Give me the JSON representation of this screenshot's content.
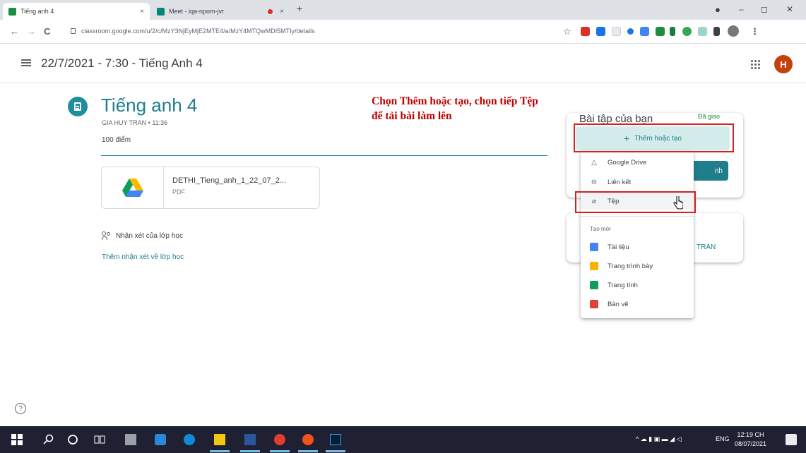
{
  "browser": {
    "tabs": [
      {
        "title": "Tiếng anh 4",
        "close": "×"
      },
      {
        "title": "Meet - iqa-npom-jvr",
        "close": "×"
      }
    ],
    "new_tab": "+",
    "window_controls": {
      "minimize": "–",
      "maximize": "◻",
      "close": "✕"
    },
    "url": "classroom.google.com/u/2/c/MzY3NjEyMjE2MTE4/a/MzY4MTQwMDI5MTIy/details",
    "nav": {
      "back": "←",
      "forward": "→",
      "reload": "C"
    }
  },
  "appbar": {
    "title": "22/7/2021 - 7:30 - Tiếng Anh 4",
    "avatar_letter": "H"
  },
  "assignment": {
    "title": "Tiếng anh 4",
    "meta": "GIA HUY TRAN • 11:36",
    "points": "100 điểm",
    "attachment": {
      "name": "DETHI_Tieng_anh_1_22_07_2...",
      "type": "PDF"
    },
    "class_comments_label": "Nhận xét của lớp học",
    "add_class_comment": "Thêm nhận xét về lớp học"
  },
  "your_work": {
    "title": "Bài tập của bạn",
    "status": "Đã giao",
    "add_button": "Thêm hoặc tạo",
    "turn_in_partial": "nh",
    "private_comment_name_partial": "TRAN"
  },
  "add_menu": {
    "items": [
      {
        "label": "Google Drive",
        "icon": "drive-icon"
      },
      {
        "label": "Liên kết",
        "icon": "link-icon"
      },
      {
        "label": "Tệp",
        "icon": "paperclip-icon"
      }
    ],
    "create_new_label": "Tạo mới",
    "create_items": [
      {
        "label": "Tài liệu",
        "icon": "docs-icon",
        "color": "#4285f4"
      },
      {
        "label": "Trang trình bày",
        "icon": "slides-icon",
        "color": "#f4b400"
      },
      {
        "label": "Trang tính",
        "icon": "sheets-icon",
        "color": "#0f9d58"
      },
      {
        "label": "Bản vẽ",
        "icon": "drawings-icon",
        "color": "#db4437"
      }
    ]
  },
  "annotation": {
    "line1": "Chọn Thêm hoặc tạo, chọn tiếp Tệp",
    "line2": "để tải bài làm lên"
  },
  "help_label": "?",
  "taskbar": {
    "tray_lang": "ENG",
    "time": "12:19 CH",
    "date": "08/07/2021"
  },
  "colors": {
    "accent": "#1e7e8c",
    "annotation_red": "#c00000",
    "taskbar_bg": "#1f2133"
  }
}
